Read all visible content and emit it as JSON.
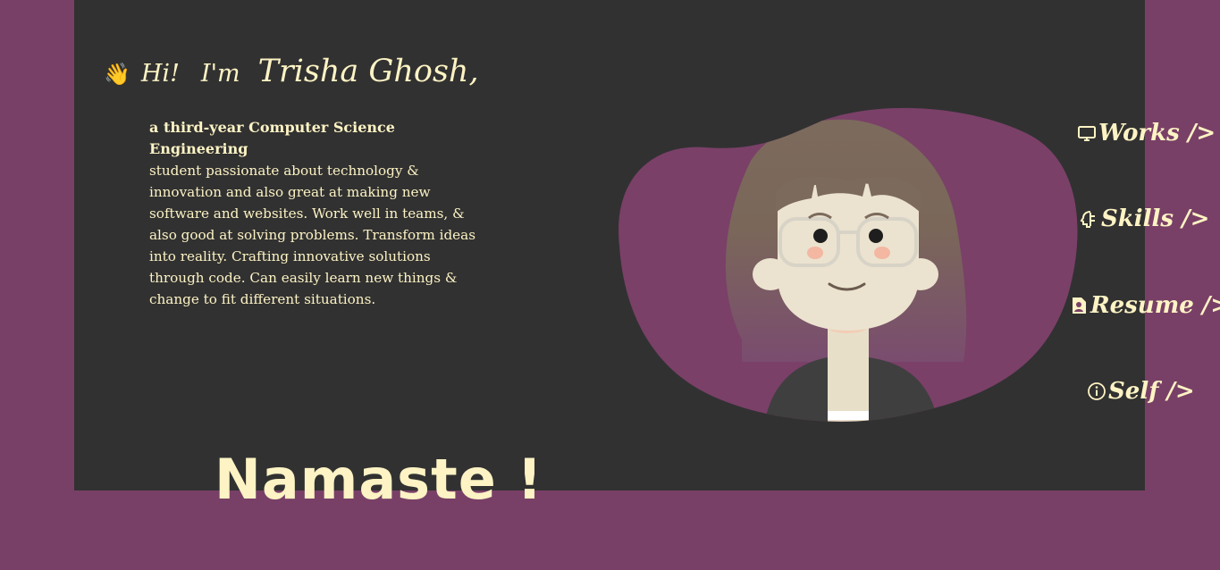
{
  "hero": {
    "wave_emoji": "👋",
    "hi": "Hi!",
    "im": "I'm",
    "name": "Trisha Ghosh,",
    "bio_lead": "a third-year Computer Science Engineering",
    "bio_body": "student passionate about technology & innovation and also great at making new software and websites. Work well in teams, & also good at solving problems. Transform ideas into reality. Crafting innovative solutions through code. Can easily learn new things & change to fit different situations.",
    "namaste": "Namaste !"
  },
  "nav": {
    "works": {
      "label": "Works />",
      "icon": "monitor-icon"
    },
    "skills": {
      "label": "Skills />",
      "icon": "brain-icon"
    },
    "resume": {
      "label": "Resume />",
      "icon": "resume-file-icon"
    },
    "self": {
      "label": "Self />",
      "icon": "info-icon"
    }
  },
  "colors": {
    "page_background": "#794067",
    "panel": "#313131",
    "text": "#fdf3c4",
    "blob": "#7a4068"
  }
}
